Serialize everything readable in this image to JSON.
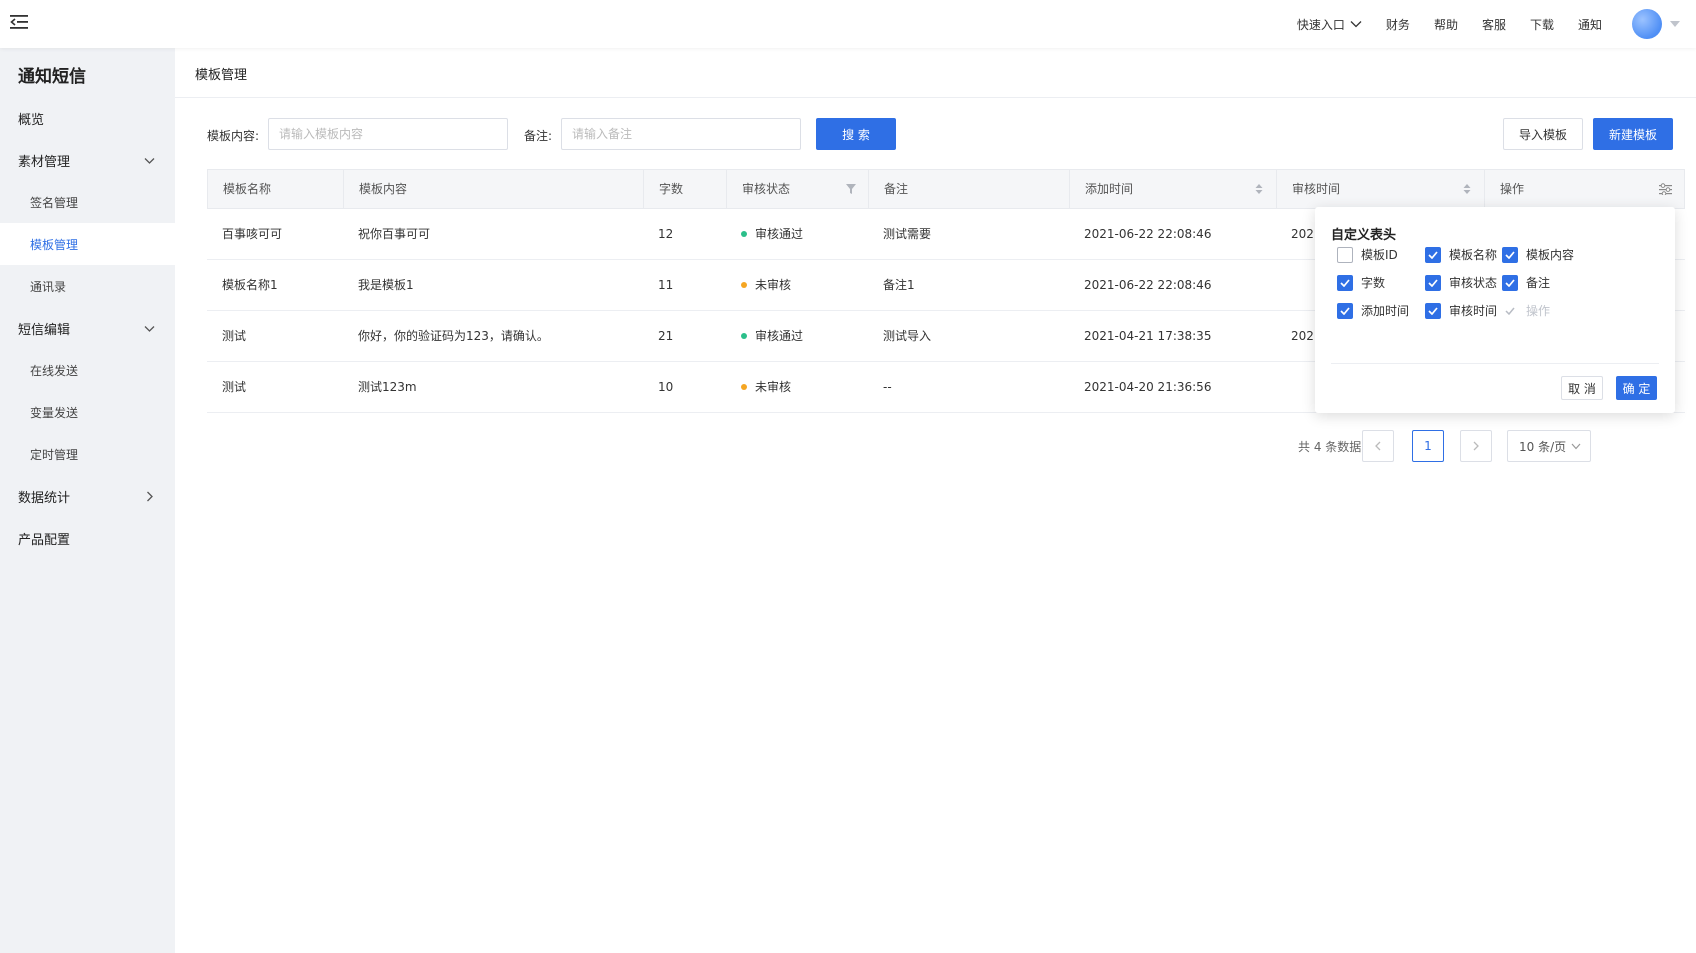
{
  "header": {
    "nav": [
      {
        "label": "快速入口",
        "dropdown": true
      },
      {
        "label": "财务"
      },
      {
        "label": "帮助"
      },
      {
        "label": "客服"
      },
      {
        "label": "下载"
      },
      {
        "label": "通知"
      }
    ]
  },
  "sidebar": {
    "title": "通知短信",
    "items": [
      {
        "label": "概览",
        "level": 1,
        "arrow": ""
      },
      {
        "label": "素材管理",
        "level": 1,
        "arrow": "down"
      },
      {
        "label": "签名管理",
        "level": 2,
        "arrow": ""
      },
      {
        "label": "模板管理",
        "level": 2,
        "arrow": "",
        "active": true
      },
      {
        "label": "通讯录",
        "level": 2,
        "arrow": ""
      },
      {
        "label": "短信编辑",
        "level": 1,
        "arrow": "down"
      },
      {
        "label": "在线发送",
        "level": 2,
        "arrow": ""
      },
      {
        "label": "变量发送",
        "level": 2,
        "arrow": ""
      },
      {
        "label": "定时管理",
        "level": 2,
        "arrow": ""
      },
      {
        "label": "数据统计",
        "level": 1,
        "arrow": "right"
      },
      {
        "label": "产品配置",
        "level": 1,
        "arrow": ""
      }
    ]
  },
  "page": {
    "title": "模板管理"
  },
  "filters": {
    "content_label": "模板内容:",
    "content_placeholder": "请输入模板内容",
    "remark_label": "备注:",
    "remark_placeholder": "请输入备注",
    "search_label": "搜 索",
    "import_label": "导入模板",
    "create_label": "新建模板"
  },
  "table": {
    "columns": [
      "模板名称",
      "模板内容",
      "字数",
      "审核状态",
      "备注",
      "添加时间",
      "审核时间",
      "操作"
    ],
    "rows": [
      {
        "name": "百事咳可可",
        "content": "祝你百事可可",
        "count": "12",
        "status": "审核通过",
        "status_color": "#2bbf8a",
        "remark": "测试需要",
        "added": "2021-06-22 22:08:46",
        "reviewed": "2021"
      },
      {
        "name": "模板名称1",
        "content": "我是模板1",
        "count": "11",
        "status": "未审核",
        "status_color": "#f5a623",
        "remark": "备注1",
        "added": "2021-06-22 22:08:46",
        "reviewed": ""
      },
      {
        "name": "测试",
        "content": "你好，你的验证码为123，请确认。",
        "count": "21",
        "status": "审核通过",
        "status_color": "#2bbf8a",
        "remark": "测试导入",
        "added": "2021-04-21 17:38:35",
        "reviewed": "2021"
      },
      {
        "name": "测试",
        "content": "测试123m",
        "count": "10",
        "status": "未审核",
        "status_color": "#f5a623",
        "remark": "--",
        "added": "2021-04-20 21:36:56",
        "reviewed": ""
      }
    ]
  },
  "pagination": {
    "total": "共 4 条数据",
    "current": "1",
    "size": "10 条/页"
  },
  "column_picker": {
    "title": "自定义表头",
    "options": [
      {
        "label": "模板ID",
        "state": "off"
      },
      {
        "label": "模板名称",
        "state": "on"
      },
      {
        "label": "模板内容",
        "state": "on"
      },
      {
        "label": "字数",
        "state": "on"
      },
      {
        "label": "审核状态",
        "state": "on"
      },
      {
        "label": "备注",
        "state": "on"
      },
      {
        "label": "添加时间",
        "state": "on"
      },
      {
        "label": "审核时间",
        "state": "on"
      },
      {
        "label": "操作",
        "state": "disabled"
      }
    ],
    "cancel_label": "取 消",
    "confirm_label": "确 定"
  },
  "colors": {
    "primary": "#2f6fe5",
    "sidebar_bg": "#f0f2f5"
  }
}
